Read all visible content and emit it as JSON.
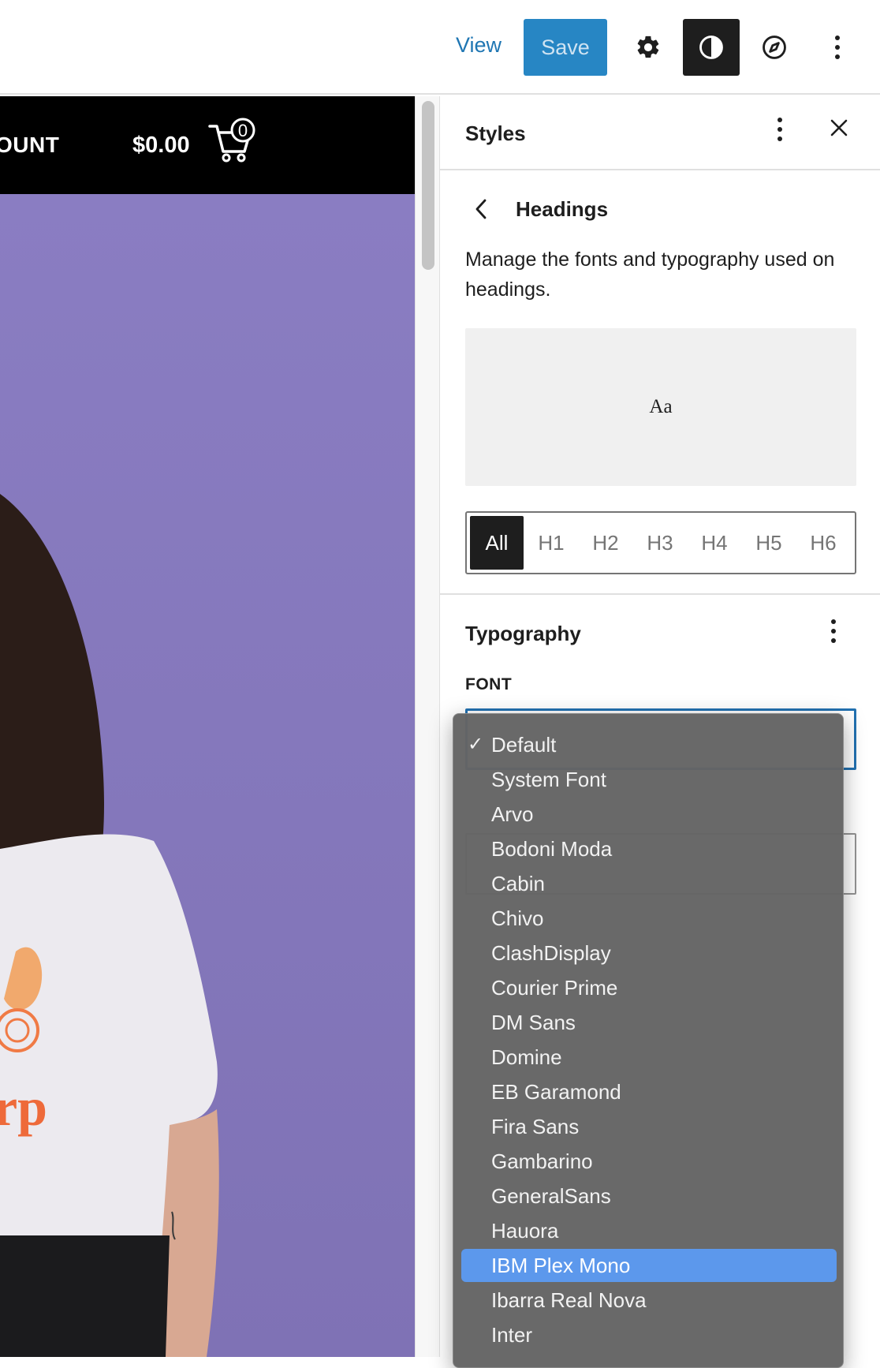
{
  "toolbar": {
    "view_label": "View",
    "save_label": "Save",
    "settings_icon": "gear-icon",
    "styles_icon": "half-circle-contrast-icon",
    "browse_icon": "compass-icon",
    "more_icon": "vertical-ellipsis-icon",
    "colors": {
      "primary": "#2786c4",
      "link": "#1f76b3",
      "dark": "#1e1e1e"
    }
  },
  "canvas": {
    "account_text": "OUNT",
    "price": "$0.00",
    "cart_count": "0",
    "background_color": "#8578bd",
    "shirt_logo_text": "rp"
  },
  "sidebar": {
    "title": "Styles",
    "section_title": "Headings",
    "description": "Manage the fonts and typography used on headings.",
    "preview_text": "Aa",
    "heading_levels": [
      "All",
      "H1",
      "H2",
      "H3",
      "H4",
      "H5",
      "H6"
    ],
    "active_level": "All",
    "typography_title": "Typography",
    "font_label": "FONT",
    "font_options": [
      "Default",
      "System Font",
      "Arvo",
      "Bodoni Moda",
      "Cabin",
      "Chivo",
      "ClashDisplay",
      "Courier Prime",
      "DM Sans",
      "Domine",
      "EB Garamond",
      "Fira Sans",
      "Gambarino",
      "GeneralSans",
      "Hauora",
      "IBM Plex Mono",
      "Ibarra Real Nova",
      "Inter"
    ],
    "selected_font": "Default",
    "hovered_font": "IBM Plex Mono",
    "checkmark": "✓"
  }
}
